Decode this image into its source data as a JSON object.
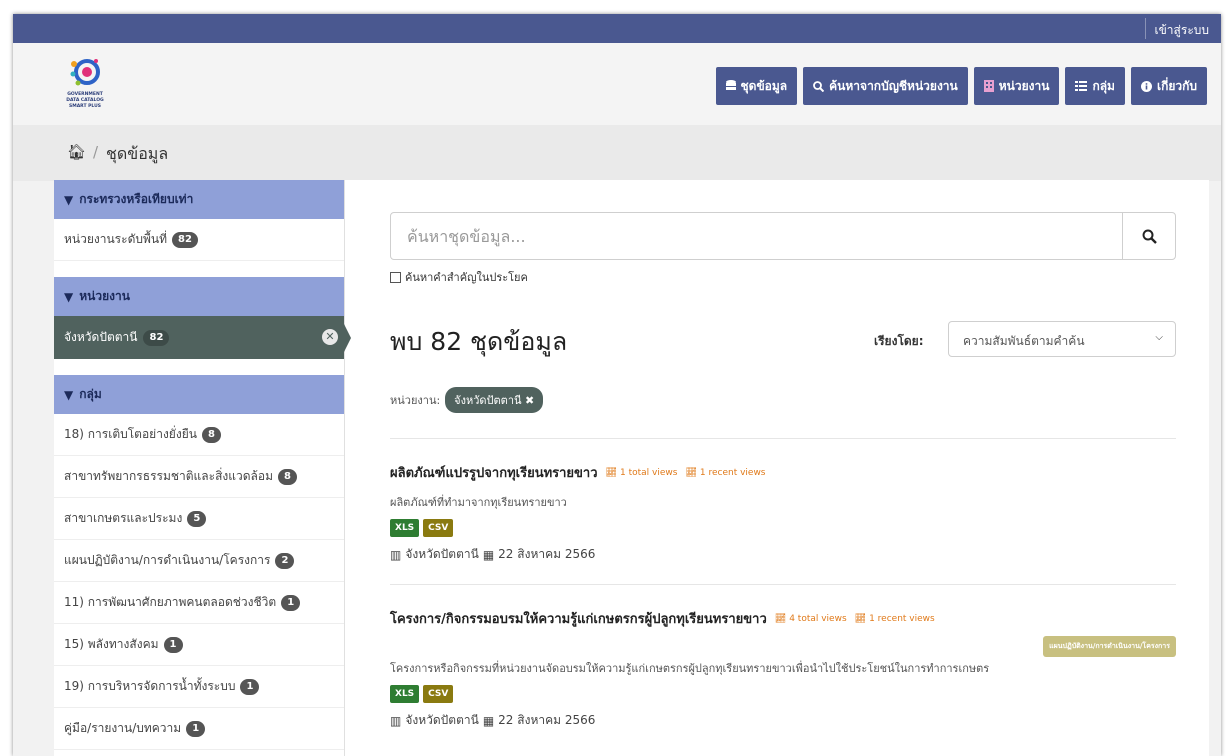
{
  "topbar": {
    "login": "เข้าสู่ระบบ"
  },
  "logo": {
    "line1": "GOVERNMENT",
    "line2": "DATA CATALOG",
    "line3": "SMART PLUS"
  },
  "nav": [
    {
      "label": "ชุดข้อมูล",
      "icon": "database-icon"
    },
    {
      "label": "ค้นหาจากบัญชีหน่วยงาน",
      "icon": "search-icon"
    },
    {
      "label": "หน่วยงาน",
      "icon": "building-icon"
    },
    {
      "label": "กลุ่ม",
      "icon": "grid-icon"
    },
    {
      "label": "เกี่ยวกับ",
      "icon": "info-icon"
    }
  ],
  "breadcrumb": {
    "current": "ชุดข้อมูล"
  },
  "sidebar": {
    "ministry": {
      "heading": "กระทรวงหรือเทียบเท่า",
      "items": [
        {
          "label": "หน่วยงานระดับพื้นที่",
          "count": "82"
        }
      ]
    },
    "org": {
      "heading": "หน่วยงาน",
      "active": {
        "label": "จังหวัดปัตตานี",
        "count": "82"
      }
    },
    "groups": {
      "heading": "กลุ่ม",
      "items": [
        {
          "label": "18) การเติบโตอย่างยั่งยืน",
          "count": "8"
        },
        {
          "label": "สาขาทรัพยากรธรรมชาติและสิ่งแวดล้อม",
          "count": "8"
        },
        {
          "label": "สาขาเกษตรและประมง",
          "count": "5"
        },
        {
          "label": "แผนปฏิบัติงาน/การดำเนินงาน/โครงการ",
          "count": "2"
        },
        {
          "label": "11) การพัฒนาศักยภาพคนตลอดช่วงชีวิต",
          "count": "1"
        },
        {
          "label": "15) พลังทางสังคม",
          "count": "1"
        },
        {
          "label": "19) การบริหารจัดการน้ำทั้งระบบ",
          "count": "1"
        },
        {
          "label": "คู่มือ/รายงาน/บทความ",
          "count": "1"
        }
      ]
    }
  },
  "search": {
    "placeholder": "ค้นหาชุดข้อมูล...",
    "checkbox_label": "ค้นหาคำสำคัญในประโยค"
  },
  "results": {
    "found": "พบ 82 ชุดข้อมูล",
    "sort_label": "เรียงโดย:",
    "sort_value": "ความสัมพันธ์ตามคำค้น"
  },
  "filter": {
    "label": "หน่วยงาน:",
    "value": "จังหวัดปัตตานี"
  },
  "datasets": [
    {
      "title": "ผลิตภัณฑ์แปรรูปจากทุเรียนทรายขาว",
      "total_views": "1 total views",
      "recent_views": "1 recent views",
      "description": "ผลิตภัณฑ์ที่ทำมาจากทุเรียนทรายขาว",
      "formats": [
        "XLS",
        "CSV"
      ],
      "org": "จังหวัดปัตตานี",
      "date": "22 สิงหาคม 2566"
    },
    {
      "title": "โครงการ/กิจกรรมอบรมให้ความรู้แก่เกษตรกรผู้ปลูกทุเรียนทรายขาว",
      "total_views": "4 total views",
      "recent_views": "1 recent views",
      "group_tag": "แผนปฏิบัติงาน/การดำเนินงาน/โครงการ",
      "description": "โครงการหรือกิจกรรมที่หน่วยงานจัดอบรมให้ความรู้แก่เกษตรกรผู้ปลูกทุเรียนทรายขาวเพื่อนำไปใช้ประโยชน์ในการทำการเกษตร",
      "formats": [
        "XLS",
        "CSV"
      ],
      "org": "จังหวัดปัตตานี",
      "date": "22 สิงหาคม 2566"
    }
  ]
}
